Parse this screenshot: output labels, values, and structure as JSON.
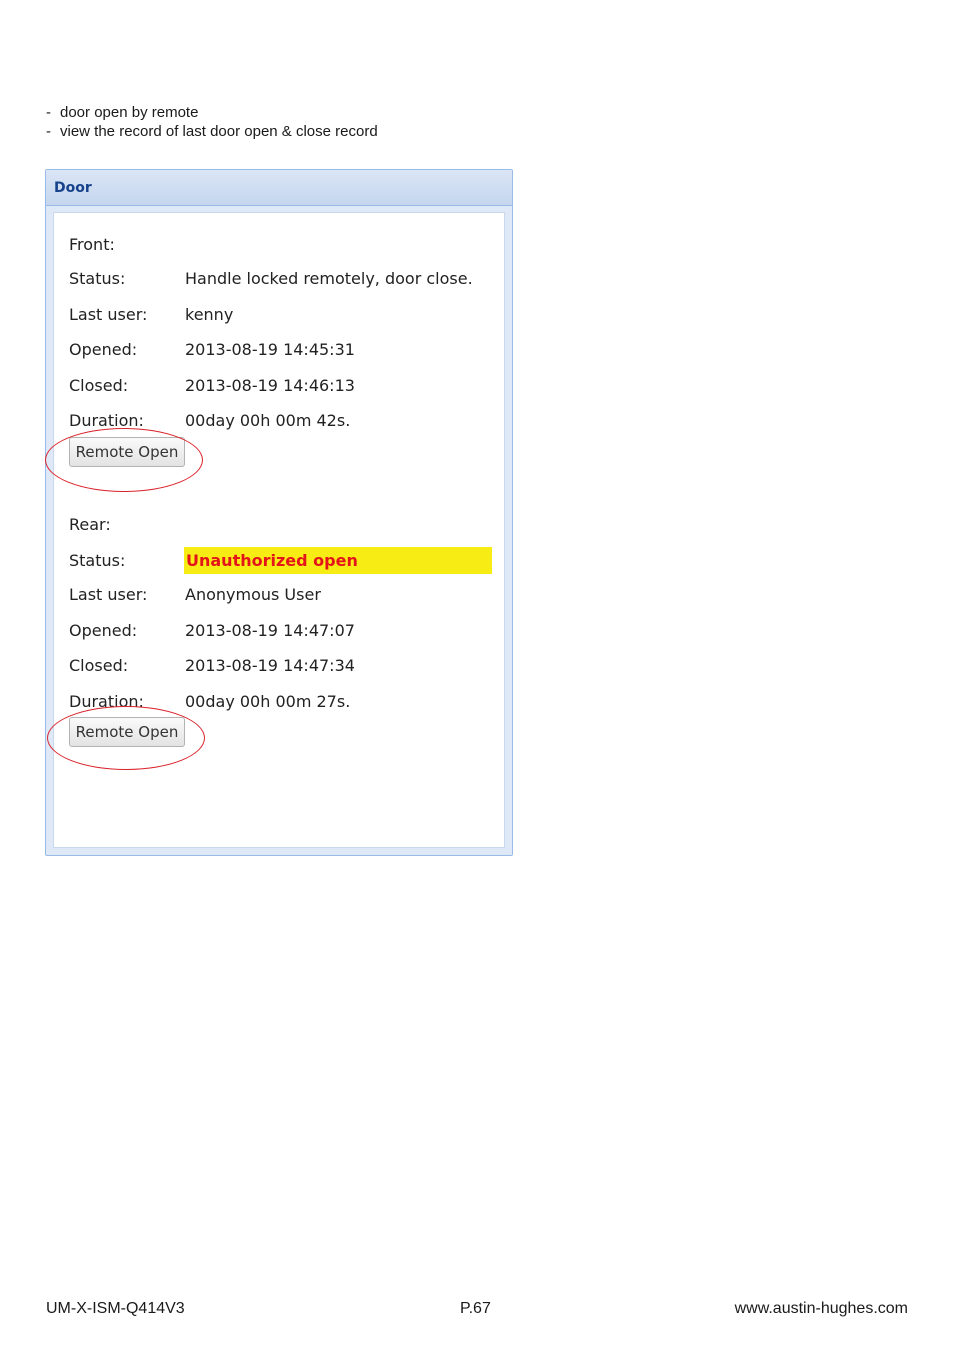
{
  "intro": {
    "bullets": [
      "door open by remote",
      "view the record of last door open & close record"
    ]
  },
  "panel": {
    "title": "Door",
    "front": {
      "heading": "Front:",
      "status_label": "Status:",
      "status_value": "Handle locked remotely, door close.",
      "last_user_label": "Last user:",
      "last_user_value": "kenny",
      "opened_label": "Opened:",
      "opened_value": "2013-08-19 14:45:31",
      "closed_label": "Closed:",
      "closed_value": "2013-08-19 14:46:13",
      "duration_label": "Duration:",
      "duration_value": "00day 00h 00m 42s.",
      "button_label": "Remote Open"
    },
    "rear": {
      "heading": "Rear:",
      "status_label": "Status:",
      "status_value": "Unauthorized open",
      "last_user_label": "Last user:",
      "last_user_value": "Anonymous User",
      "opened_label": "Opened:",
      "opened_value": "2013-08-19 14:47:07",
      "closed_label": "Closed:",
      "closed_value": "2013-08-19 14:47:34",
      "duration_label": "Duration:",
      "duration_value": "00day 00h 00m 27s.",
      "button_label": "Remote Open"
    }
  },
  "footer": {
    "doc_id": "UM-X-ISM-Q414V3",
    "page": "P.67",
    "website": "www.austin-hughes.com"
  },
  "colors": {
    "panel_title": "#15428b",
    "alert_background": "#f7ec14",
    "alert_text": "#e3141a",
    "highlight_circle": "#d9232b"
  }
}
